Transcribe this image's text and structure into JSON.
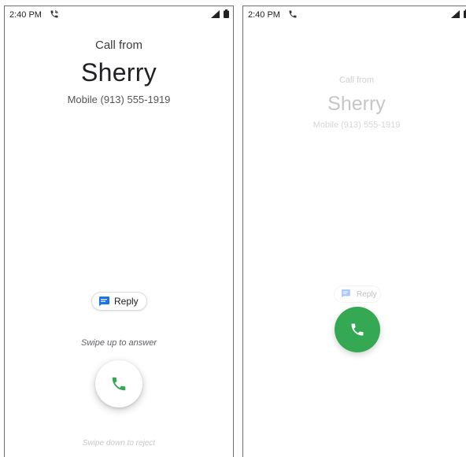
{
  "left_screen": {
    "status_time": "2:40 PM",
    "call_from": "Call from",
    "caller_name": "Sherry",
    "caller_number": "Mobile (913) 555-1919",
    "reply_label": "Reply",
    "swipe_up_hint": "Swipe up to answer",
    "swipe_down_hint": "Swipe down to reject",
    "icons": [
      "wifi-call-icon",
      "signal-icon",
      "battery-icon",
      "message-icon",
      "phone-icon"
    ]
  },
  "right_screen": {
    "status_time": "2:40 PM",
    "call_from": "Call from",
    "caller_name": "Sherry",
    "caller_number": "Mobile (913) 555-1919",
    "reply_label": "Reply",
    "icons": [
      "phone-icon",
      "signal-icon",
      "battery-icon",
      "message-icon",
      "phone-icon"
    ]
  },
  "colors": {
    "accent_green": "#34a853",
    "reply_icon_blue": "#1a73e8"
  }
}
